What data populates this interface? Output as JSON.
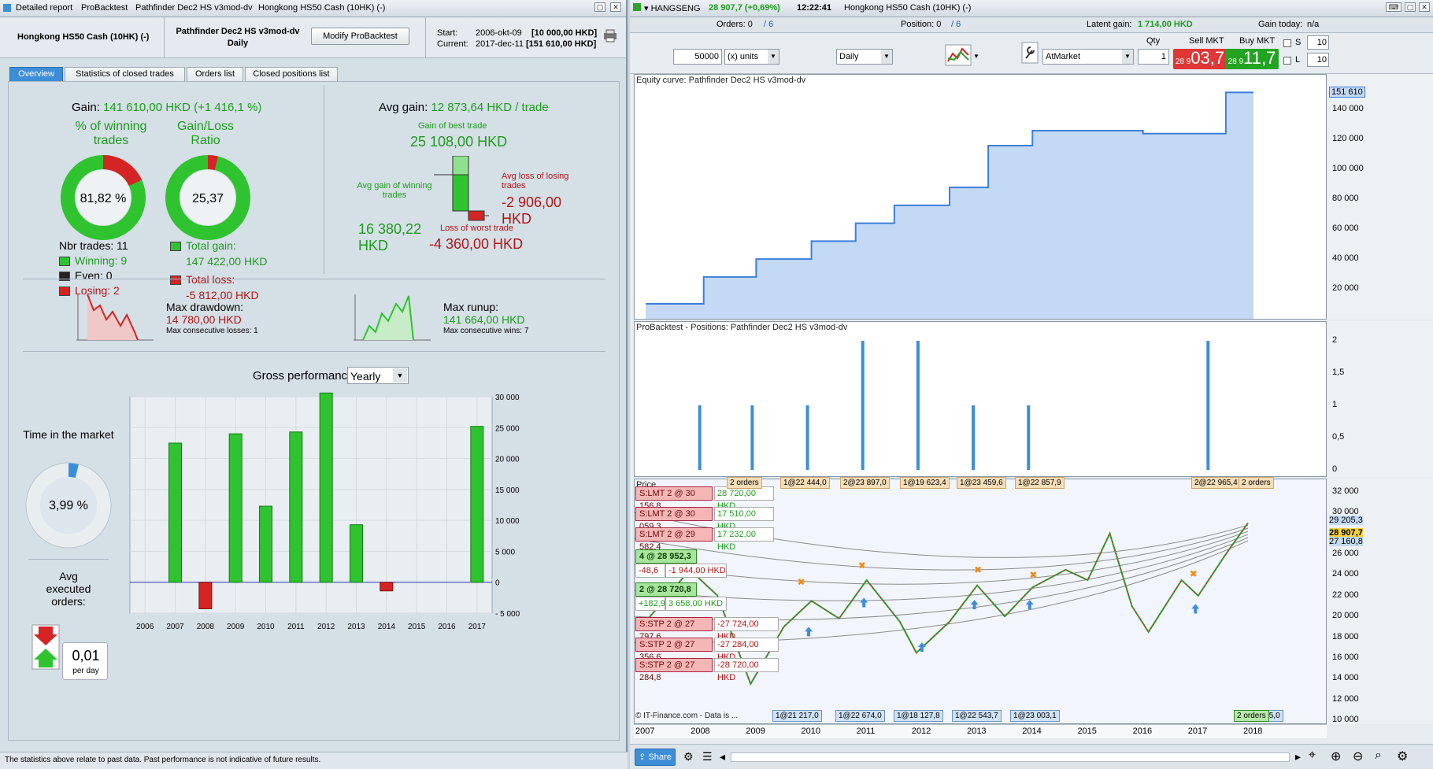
{
  "left": {
    "titlebar": [
      "Detailed report",
      "ProBacktest",
      "Pathfinder Dec2 HS v3mod-dv",
      "Hongkong HS50 Cash (10HK) (-)"
    ],
    "instrument": "Hongkong HS50 Cash (10HK) (-)",
    "strategy": "Pathfinder Dec2 HS v3mod-dv",
    "timeframe": "Daily",
    "modify_label": "Modify ProBacktest",
    "start_label": "Start:",
    "start_date": "2006-okt-09",
    "start_val": "[10 000,00 HKD]",
    "current_label": "Current:",
    "current_date": "2017-dec-11",
    "current_val": "[151 610,00 HKD]",
    "tabs": [
      "Overview",
      "Statistics of closed trades",
      "Orders list",
      "Closed positions list"
    ],
    "gain_label": "Gain:",
    "gain_value": "141 610,00 HKD (+1 416,1 %)",
    "winpct_title": "% of winning trades",
    "winpct_value": "81,82 %",
    "ratio_title": "Gain/Loss Ratio",
    "ratio_value": "25,37",
    "nbr_trades": "Nbr trades: 11",
    "winning": "Winning: 9",
    "even": "Even: 0",
    "losing": "Losing: 2",
    "total_gain_label": "Total gain:",
    "total_gain": "147 422,00 HKD",
    "total_loss_label": "Total loss:",
    "total_loss": "-5 812,00 HKD",
    "avg_gain_label": "Avg gain:",
    "avg_gain": "12 873,64 HKD / trade",
    "best_label": "Gain of best trade",
    "best_value": "25 108,00 HKD",
    "avg_win_label": "Avg gain of winning trades",
    "avg_win_value": "16 380,22 HKD",
    "avg_loss_label": "Avg loss of losing trades",
    "avg_loss_value": "-2 906,00 HKD",
    "worst_label": "Loss of worst trade",
    "worst_value": "-4 360,00 HKD",
    "drawdown_label": "Max drawdown:",
    "drawdown_value": "14 780,00 HKD",
    "drawdown_sub": "Max consecutive losses: 1",
    "runup_label": "Max runup:",
    "runup_value": "141 664,00 HKD",
    "runup_sub": "Max consecutive wins: 7",
    "time_label": "Time in the market",
    "time_value": "3,99 %",
    "avgexec_label": "Avg executed orders:",
    "avgexec_value": "0,01",
    "avgexec_unit": "per day",
    "gross_label": "Gross performance",
    "gross_select": "Yearly",
    "footer": "The statistics above relate to past data. Past performance is not indicative of future results."
  },
  "colors": {
    "green": "#2fc42f",
    "red": "#d42424",
    "blue": "#3d8ed8"
  },
  "chart_data": [
    {
      "type": "bar",
      "title": "Gross performance",
      "categories": [
        "2006",
        "2007",
        "2008",
        "2009",
        "2010",
        "2011",
        "2012",
        "2013",
        "2014",
        "2015",
        "2016",
        "2017"
      ],
      "values": [
        0,
        22500,
        -4300,
        24000,
        12300,
        24300,
        30600,
        9300,
        -1400,
        0,
        0,
        25200
      ],
      "yticks": [
        "30 000",
        "25 000",
        "20 000",
        "15 000",
        "10 000",
        "5 000",
        "0",
        "- 5 000"
      ],
      "ylim": [
        -5000,
        30000
      ],
      "grid": true
    },
    {
      "type": "area",
      "title": "Equity curve: Pathfinder Dec2 HS v3mod-dv",
      "yticks": [
        "140 000",
        "120 000",
        "100 000",
        "80 000",
        "60 000",
        "40 000",
        "20 000"
      ],
      "last": "151 610",
      "x": [
        2007.0,
        2008.0,
        2008.05,
        2009.0,
        2010.0,
        2010.8,
        2011.5,
        2012.5,
        2013.2,
        2014.0,
        2016.0,
        2017.5
      ],
      "y": [
        10000,
        10000,
        28000,
        40000,
        52000,
        64000,
        76000,
        88000,
        116000,
        126000,
        124000,
        151610
      ]
    },
    {
      "type": "bar",
      "title": "ProBacktest - Positions: Pathfinder Dec2 HS v3mod-dv",
      "yticks": [
        "2",
        "1,5",
        "1",
        "0,5",
        "0"
      ]
    },
    {
      "type": "line",
      "title": "Price",
      "yticks": [
        "32 000",
        "30 000",
        "28 000",
        "26 000",
        "24 000",
        "22 000",
        "20 000",
        "18 000",
        "16 000",
        "14 000",
        "12 000",
        "10 000"
      ],
      "xticks": [
        "2007",
        "2008",
        "2009",
        "2010",
        "2011",
        "2012",
        "2013",
        "2014",
        "2015",
        "2016",
        "2017",
        "2018"
      ],
      "last": "28 907,7"
    }
  ],
  "right": {
    "title_symbol": "HANGSENG",
    "title_price": "28 907,7 (+0,69%)",
    "title_time": "12:22:41",
    "title_inst": "Hongkong HS50 Cash (10HK) (-)",
    "orders": "Orders: 0",
    "orders_of": "/ 6",
    "position": "Position: 0",
    "position_of": "/ 6",
    "latent_label": "Latent gain:",
    "latent_value": "1 714,00 HKD",
    "gain_today": "Gain today:",
    "gain_today_val": "n/a",
    "units_value": "50000",
    "units_label": "(x) units",
    "period": "Daily",
    "order_type": "AtMarket",
    "qty_label": "Qty",
    "qty": "1",
    "sell_label": "Sell MKT",
    "sell_small": "28 9",
    "sell_big": "03,7",
    "buy_label": "Buy MKT",
    "buy_small": "28 9",
    "buy_big": "11,7",
    "s_label": "S",
    "s_val": "10",
    "l_label": "L",
    "l_val": "10",
    "price_tags": [
      {
        "t": "S:LMT  2 @ 30 156,8",
        "v": "28 720,00 HKD"
      },
      {
        "t": "S:LMT  2 @ 30 059,3",
        "v": "17 510,00 HKD"
      },
      {
        "t": "S:LMT  2 @ 29 582,4",
        "v": "17 232,00 HKD"
      }
    ],
    "pos1": "4 @ 28 952,3",
    "pos1_a": "-48,6",
    "pos1_b": "-1 944,00 HKD",
    "pos2": "2 @ 28 720,8",
    "pos2_a": "+182,9",
    "pos2_b": "3 658,00 HKD",
    "stp_tags": [
      {
        "t": "S:STP  2 @ 27 797,6",
        "v": "-27 724,00 HKD"
      },
      {
        "t": "S:STP  2 @ 27 356,6",
        "v": "-27 284,00 HKD"
      },
      {
        "t": "S:STP  2 @ 27 284,8",
        "v": "-28 720,00 HKD"
      }
    ],
    "top_tags": [
      "2 orders",
      "1@22 444,0",
      "2@23 897,0",
      "1@19 623,4",
      "1@23 459,6",
      "1@22 857,9",
      "2@22 965,4",
      "2 orders"
    ],
    "bot_tags": [
      "1@21 217,0",
      "1@22 674,0",
      "1@18 127,8",
      "1@22 543,7",
      "1@23 003,1",
      "1@21 915,0",
      "2 orders"
    ],
    "right_prices": [
      "29 205,3",
      "28 907,7",
      "27 160,8"
    ],
    "share": "Share",
    "copyright": "© IT-Finance.com - Data is ..."
  }
}
